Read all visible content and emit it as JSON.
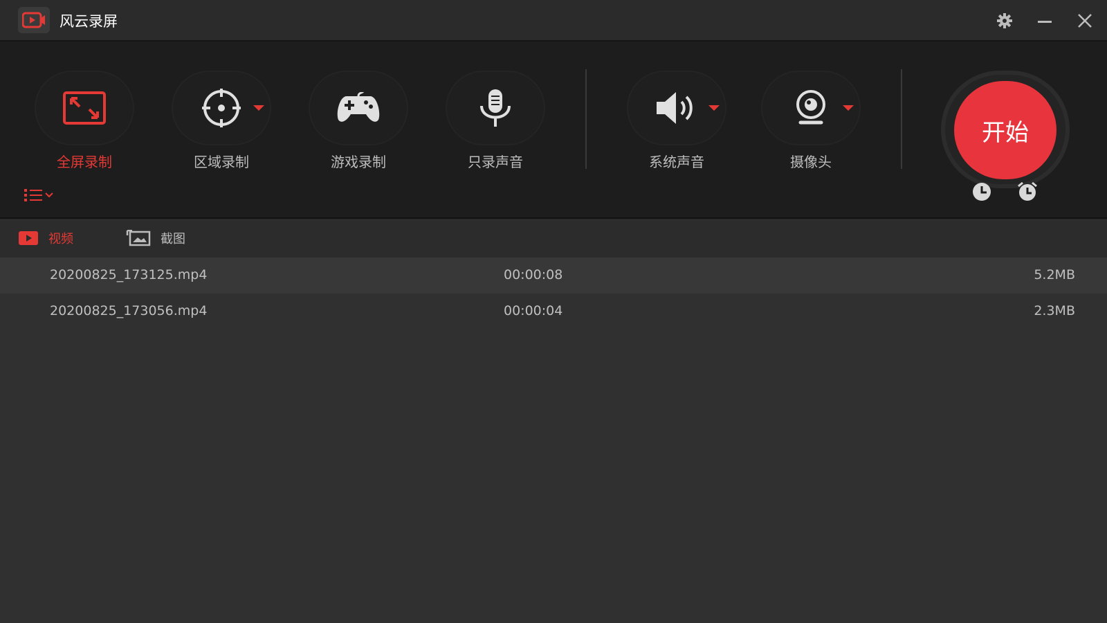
{
  "app": {
    "title": "风云录屏"
  },
  "window_controls": {
    "settings": "gear-icon",
    "minimize": "minimize-icon",
    "close": "close-icon"
  },
  "toolbar": {
    "tools": [
      {
        "label": "全屏录制",
        "icon": "fullscreen-icon",
        "active": true
      },
      {
        "label": "区域录制",
        "icon": "target-icon",
        "active": false
      },
      {
        "label": "游戏录制",
        "icon": "gamepad-icon",
        "active": false
      },
      {
        "label": "只录声音",
        "icon": "microphone-icon",
        "active": false
      },
      {
        "label": "系统声音",
        "icon": "speaker-icon",
        "active": false
      },
      {
        "label": "摄像头",
        "icon": "webcam-icon",
        "active": false
      }
    ],
    "start_label": "开始"
  },
  "tabs": [
    {
      "label": "视频",
      "icon": "video-icon",
      "active": true
    },
    {
      "label": "截图",
      "icon": "image-icon",
      "active": false
    }
  ],
  "files": [
    {
      "name": "20200825_173125.mp4",
      "duration": "00:00:08",
      "size": "5.2MB"
    },
    {
      "name": "20200825_173056.mp4",
      "duration": "00:00:04",
      "size": "2.3MB"
    }
  ],
  "colors": {
    "accent": "#e53935",
    "background": "#2d2d2d",
    "toolbar": "#1d1d1d"
  }
}
